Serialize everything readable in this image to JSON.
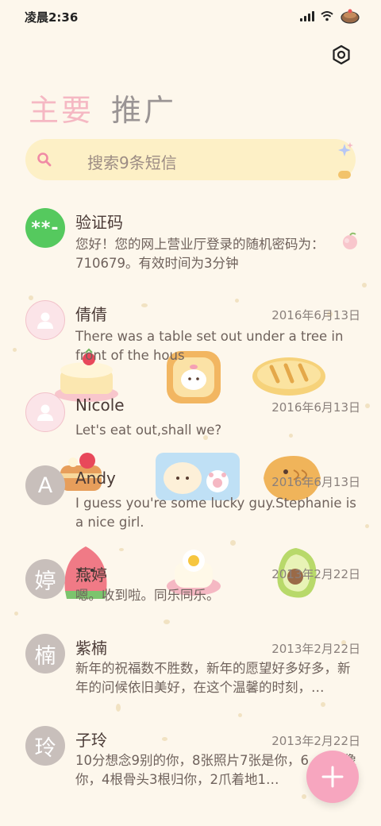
{
  "status_bar": {
    "time": "凌晨2:36",
    "icons": [
      "signal-icon",
      "wifi-icon",
      "cake-icon"
    ]
  },
  "header": {
    "settings_icon": "settings-icon"
  },
  "tabs": [
    {
      "label": "主要",
      "active": true
    },
    {
      "label": "推广",
      "active": false
    }
  ],
  "search": {
    "placeholder": "搜索9条短信"
  },
  "messages": [
    {
      "sender": "验证码",
      "date": "",
      "avatar_type": "code",
      "avatar_text": "**-",
      "preview": "您好！您的网上营业厅登录的随机密码为：710679。有效时间为3分钟"
    },
    {
      "sender": "倩倩",
      "date": "2016年6月13日",
      "avatar_type": "person",
      "avatar_text": "",
      "preview": "There was a table set out under a tree in front of the hous"
    },
    {
      "sender": "Nicole",
      "date": "2016年6月13日",
      "avatar_type": "person",
      "avatar_text": "",
      "preview": "Let's eat out,shall we?"
    },
    {
      "sender": "Andy",
      "date": "2016年6月13日",
      "avatar_type": "letter",
      "avatar_text": "A",
      "preview": "I guess you're some lucky guy.Stephanie is a nice girl."
    },
    {
      "sender": "燕婷",
      "date": "2013年2月22日",
      "avatar_type": "letter",
      "avatar_text": "婷",
      "preview": "嗯。收到啦。同乐同乐。"
    },
    {
      "sender": "紫楠",
      "date": "2013年2月22日",
      "avatar_type": "letter",
      "avatar_text": "楠",
      "preview": "新年的祝福数不胜数，新年的愿望好多好多，新年的问候依旧美好，在这个温馨的时刻，…"
    },
    {
      "sender": "子玲",
      "date": "2013年2月22日",
      "avatar_type": "letter",
      "avatar_text": "玲",
      "preview": "10分想念9别的你，8张照片7张是你，6…5只像你，4根骨头3根归你，2爪着地1…"
    }
  ],
  "fab": {
    "label": "+",
    "icon": "plus-icon"
  },
  "colors": {
    "background": "#fdf7ec",
    "accent_pink": "#f5b8c3",
    "search_bg": "#fdf0c6",
    "fab": "#f7a6bf",
    "code_avatar": "#55c95e"
  }
}
